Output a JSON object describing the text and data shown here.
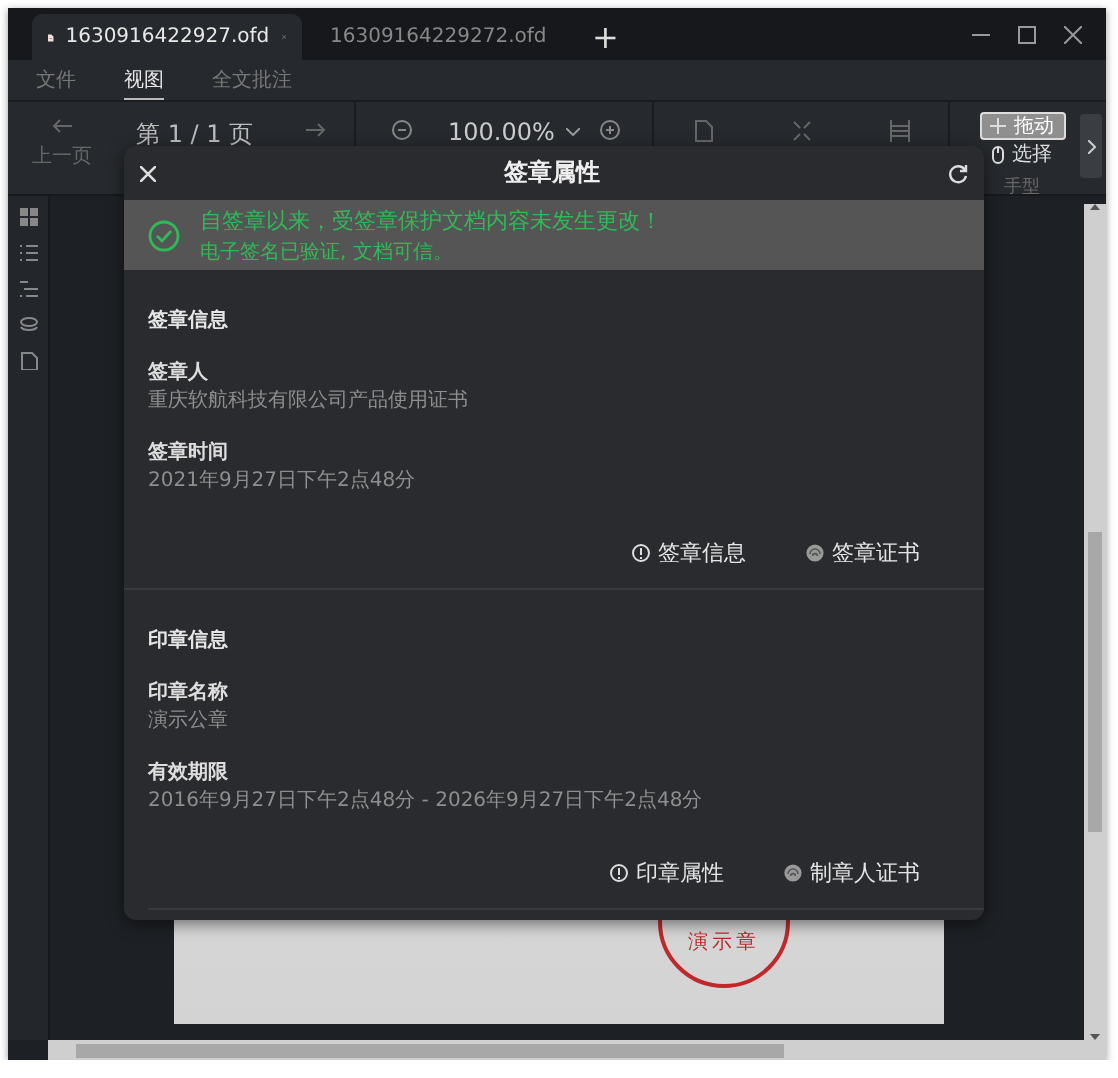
{
  "tabs": [
    {
      "title": "1630916422927.ofd",
      "selected": true
    },
    {
      "title": "16309164229272.ofd",
      "selected": false
    }
  ],
  "new_tab": "+",
  "menu": [
    {
      "label": "文件",
      "selected": false
    },
    {
      "label": "视图",
      "selected": true
    },
    {
      "label": "全文批注",
      "selected": false
    }
  ],
  "toolbar": {
    "prev_page": "上一页",
    "page_indicator": "第 1 / 1 页",
    "zoom": "100.00%",
    "modes": [
      {
        "label": "拖动",
        "selected": true
      },
      {
        "label": "选择",
        "selected": false
      }
    ],
    "mode_group": "手型"
  },
  "document": {
    "seal_text": "演示章"
  },
  "dialog": {
    "title": "签章属性",
    "banner": {
      "headline": "自签章以来，受签章保护文档内容未发生更改！",
      "detail": "电子签名已验证, 文档可信。"
    },
    "sections": [
      {
        "heading": "签章信息",
        "fields": [
          {
            "label": "签章人",
            "value": "重庆软航科技有限公司产品使用证书"
          },
          {
            "label": "签章时间",
            "value": "2021年9月27日下午2点48分"
          }
        ],
        "actions": [
          {
            "kind": "info",
            "label": "签章信息"
          },
          {
            "kind": "certificate",
            "label": "签章证书"
          }
        ]
      },
      {
        "heading": "印章信息",
        "fields": [
          {
            "label": "印章名称",
            "value": "演示公章"
          },
          {
            "label": "有效期限",
            "value": "2016年9月27日下午2点48分 - 2026年9月27日下午2点48分"
          }
        ],
        "actions": [
          {
            "kind": "info",
            "label": "印章属性"
          },
          {
            "kind": "certificate",
            "label": "制章人证书"
          }
        ]
      }
    ]
  }
}
